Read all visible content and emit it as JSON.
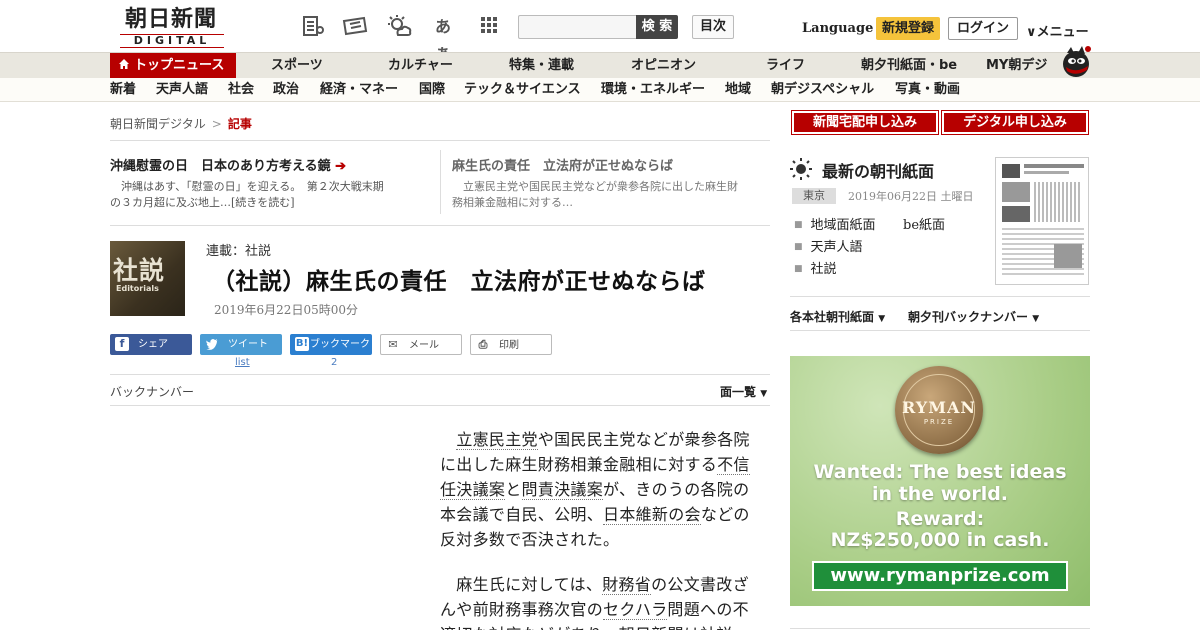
{
  "header": {
    "logo_text": "朝日新聞",
    "logo_sub": "DIGITAL",
    "font_size_label": "あぁ",
    "search_button": "検 索",
    "toc_button": "目次",
    "language": "Language",
    "signup": "新規登録",
    "login": "ログイン",
    "menu": "メニュー"
  },
  "nav1": [
    "トップニュース",
    "スポーツ",
    "カルチャー",
    "特集・連載",
    "オピニオン",
    "ライフ",
    "朝夕刊紙面・be",
    "MY朝デジ"
  ],
  "nav2": [
    "新着",
    "天声人語",
    "社会",
    "政治",
    "経済・マネー",
    "国際",
    "テック＆サイエンス",
    "環境・エネルギー",
    "地域",
    "朝デジスペシャル",
    "写真・動画"
  ],
  "breadcrumb": {
    "home": "朝日新聞デジタル",
    "sep": ">",
    "current": "記事"
  },
  "related": [
    {
      "title": "沖縄慰霊の日　日本のあり方考える鏡",
      "line1": "　沖縄はあす、「慰霊の日」を迎える。　第２次大戦末期",
      "line2": "の３カ月超に及ぶ地上…[続きを読む]"
    },
    {
      "title": "麻生氏の責任　立法府が正せぬならば",
      "line1": "　立憲民主党や国民民主党などが衆参各院に出した麻生財",
      "line2": "務相兼金融相に対する…"
    }
  ],
  "article": {
    "image_big": "社説",
    "image_small": "Editorials",
    "series": "連載：社説",
    "title": "（社説）麻生氏の責任　立法府が正せぬならば",
    "date": "2019年6月22日05時00分"
  },
  "share": {
    "facebook": "シェア",
    "twitter": "ツイート",
    "hatena": "ブックマーク",
    "mail": "メール",
    "print": "印刷",
    "twitter_sub": "list",
    "hatena_count": "2"
  },
  "backnumber": "バックナンバー",
  "list_all": "面一覧",
  "body": {
    "p1": [
      {
        "t": "　",
        "k": false
      },
      {
        "t": "立憲民主党",
        "k": true
      },
      {
        "t": "や国民民主党などが衆参各院に出した麻生財務相兼金融相に対する",
        "k": false
      },
      {
        "t": "不信任決議案",
        "k": true
      },
      {
        "t": "と",
        "k": false
      },
      {
        "t": "問責決議案",
        "k": true
      },
      {
        "t": "が、きのうの各院の本会議で自民、公明、",
        "k": false
      },
      {
        "t": "日本維新の会",
        "k": true
      },
      {
        "t": "などの反対多数で否決された。",
        "k": false
      }
    ],
    "p2": [
      {
        "t": "　麻生氏に対しては、",
        "k": false
      },
      {
        "t": "財務省",
        "k": true
      },
      {
        "t": "の公文書改ざんや前財務事務次官の",
        "k": false
      },
      {
        "t": "セクハラ",
        "k": true
      },
      {
        "t": "問題への不適切な対応などがあり、朝日新聞は社説",
        "k": false
      }
    ]
  },
  "sidebar": {
    "subscribe_paper": "新聞宅配申し込み",
    "subscribe_digital": "デジタル申し込み",
    "latest_title": "最新の朝刊紙面",
    "region": "東京",
    "paper_date": "2019年06月22日 土曜日",
    "links": [
      "地域面紙面",
      "be紙面",
      "天声人語",
      "社説"
    ],
    "drop1": "各本社朝刊紙面",
    "drop2": "朝夕刊バックナンバー"
  },
  "ad": {
    "medal_title": "RYMAN",
    "medal_sub": "PRIZE",
    "line1": "Wanted: The best ideas",
    "line2": "in the world.",
    "line3": "Reward:",
    "line4": "NZ$250,000 in cash.",
    "url": "www.rymanprize.com"
  },
  "colors": {
    "brand_red": "#b70000",
    "signup_yellow": "#f5c33b",
    "nav_bg": "#e9e7df"
  }
}
